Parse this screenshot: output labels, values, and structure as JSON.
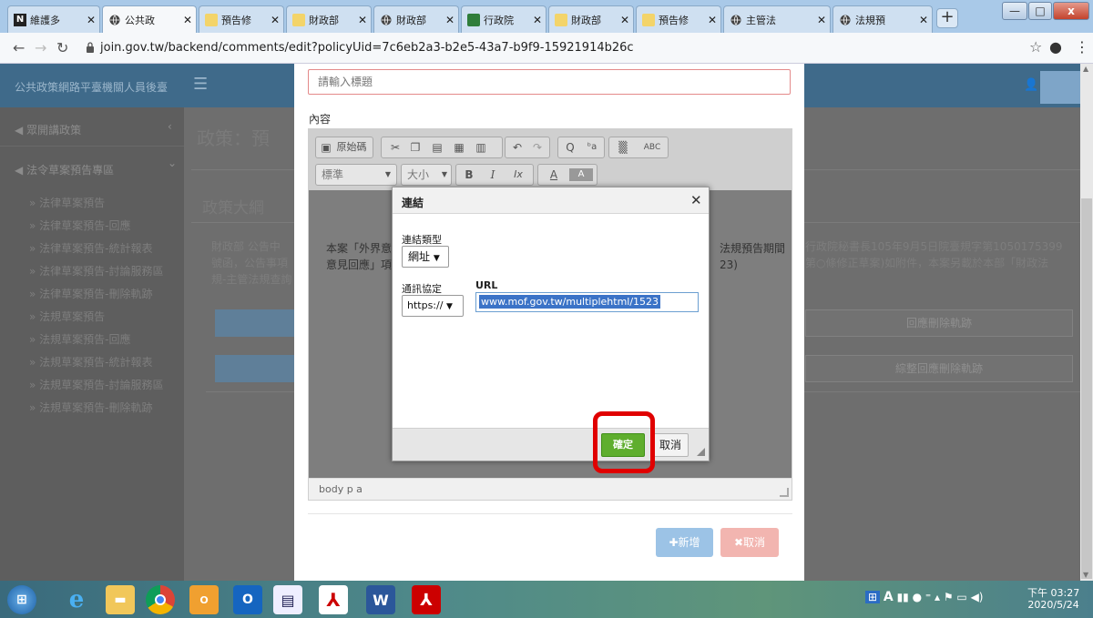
{
  "browser": {
    "tabs": [
      {
        "label": "維護多",
        "icon": "N"
      },
      {
        "label": "公共政",
        "icon": "globe"
      },
      {
        "label": "預告修",
        "icon": "doc"
      },
      {
        "label": "財政部",
        "icon": "doc"
      },
      {
        "label": "財政部",
        "icon": "globe"
      },
      {
        "label": "行政院",
        "icon": "doc"
      },
      {
        "label": "財政部",
        "icon": "doc"
      },
      {
        "label": "預告修",
        "icon": "doc"
      },
      {
        "label": "主管法",
        "icon": "globe"
      },
      {
        "label": "法規預",
        "icon": "globe"
      }
    ],
    "new_tab": "+",
    "url": "join.gov.tw/backend/comments/edit?policyUid=7c6eb2a3-b2e5-43a7-b9f9-15921914b26c",
    "window_controls": {
      "minimize": "—",
      "maximize": "□",
      "close": "x"
    }
  },
  "app": {
    "brand": "公共政策網路平臺機關人員後臺",
    "sidebar": {
      "items": [
        {
          "label": "眾開講政策",
          "chevron": "‹"
        },
        {
          "label": "法令草案預告專區",
          "chevron": "⌄"
        }
      ],
      "subitems": [
        "法律草案預告",
        "法律草案預告-回應",
        "法律草案預告-統計報表",
        "法律草案預告-討論服務區",
        "法律草案預告-刪除軌跡",
        "法規草案預告",
        "法規草案預告-回應",
        "法規草案預告-統計報表",
        "法規草案預告-討論服務區",
        "法規草案預告-刪除軌跡"
      ]
    },
    "main": {
      "policy_title": "政策：預",
      "outline_heading": "政策大綱",
      "outline_text": [
        "財政部 公告中",
        "號函，公告事項",
        "規-主管法規查詢"
      ],
      "right_text": [
        "行政院秘書長105年9月5日院臺規字第1050175399",
        "第○條修正草案)如附件，本案另載於本部「財政法"
      ],
      "right_buttons": [
        "回應刪除軌跡",
        "綜整回應刪除軌跡"
      ]
    }
  },
  "modal": {
    "title_placeholder": "請輸入標題",
    "content_label": "內容",
    "toolbar": {
      "source_label": "原始碼",
      "format_label": "標準",
      "size_label": "大小",
      "bold": "B",
      "italic": "I",
      "clear": "Ix",
      "text_color": "A",
      "bg_color": "A",
      "spell": "ABC",
      "find": "Q"
    },
    "editor_text": [
      "本案「外界意",
      "意見回應」項"
    ],
    "editor_right_text": [
      "法規預告期間",
      "23)"
    ],
    "path_text": "body  p  a",
    "add_button": "新增",
    "cancel_button": "取消"
  },
  "link_dialog": {
    "title": "連結",
    "close": "✕",
    "link_type_label": "連結類型",
    "link_type_value": "網址",
    "protocol_label": "通訊協定",
    "protocol_value": "https://",
    "url_label": "URL",
    "url_value": "www.mof.gov.tw/multiplehtml/1523",
    "ok_button": "確定",
    "cancel_button": "取消"
  },
  "taskbar": {
    "apps": [
      "start",
      "ie",
      "folder",
      "chrome",
      "outlook",
      "outlook2",
      "notepad",
      "acrobat",
      "word",
      "pdf"
    ],
    "tray_text": "A",
    "time": "下午 03:27",
    "date": "2020/5/24"
  },
  "colors": {
    "accent_green": "#5fae2e",
    "highlight_red": "#e00000",
    "add_blue": "#9cc3e6",
    "cancel_red": "#f2b5b0"
  }
}
